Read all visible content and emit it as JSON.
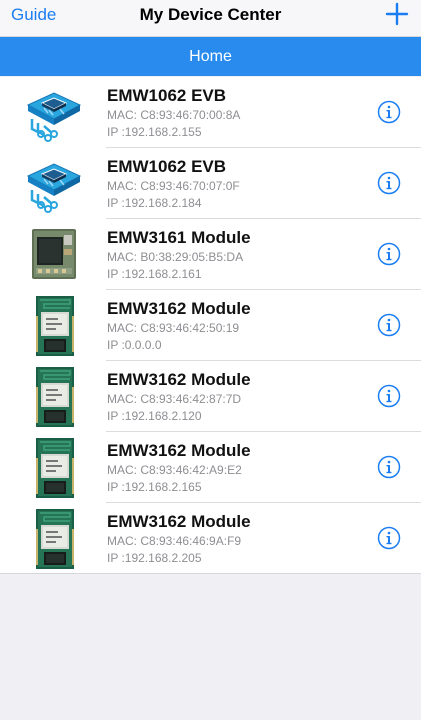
{
  "navbar": {
    "left_label": "Guide",
    "title": "My Device Center",
    "add_icon": "plus-icon"
  },
  "section": {
    "title": "Home"
  },
  "colors": {
    "accent": "#1a7df2",
    "header_bar": "#2a8bee",
    "background": "#efeff4"
  },
  "devices": [
    {
      "name": "EMW1062 EVB",
      "mac": "MAC: C8:93:46:70:00:8A",
      "ip": "IP :192.168.2.155",
      "icon": "evb-board-icon"
    },
    {
      "name": "EMW1062 EVB",
      "mac": "MAC: C8:93:46:70:07:0F",
      "ip": "IP :192.168.2.184",
      "icon": "evb-board-icon"
    },
    {
      "name": "EMW3161 Module",
      "mac": "MAC: B0:38:29:05:B5:DA",
      "ip": "IP :192.168.2.161",
      "icon": "emw3161-module-icon"
    },
    {
      "name": "EMW3162 Module",
      "mac": "MAC: C8:93:46:42:50:19",
      "ip": "IP :0.0.0.0",
      "icon": "emw3162-module-icon"
    },
    {
      "name": "EMW3162 Module",
      "mac": "MAC: C8:93:46:42:87:7D",
      "ip": "IP :192.168.2.120",
      "icon": "emw3162-module-icon"
    },
    {
      "name": "EMW3162 Module",
      "mac": "MAC: C8:93:46:42:A9:E2",
      "ip": "IP :192.168.2.165",
      "icon": "emw3162-module-icon"
    },
    {
      "name": "EMW3162 Module",
      "mac": "MAC: C8:93:46:46:9A:F9",
      "ip": "IP :192.168.2.205",
      "icon": "emw3162-module-icon"
    }
  ]
}
